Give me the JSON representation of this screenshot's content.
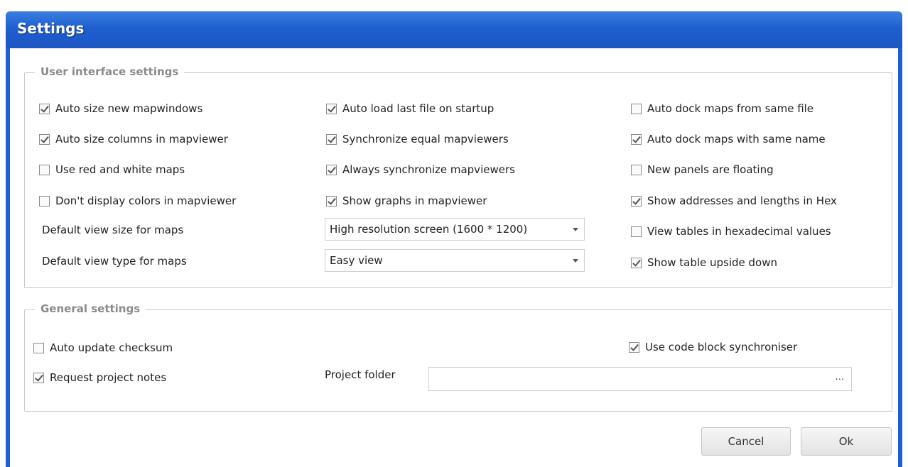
{
  "window": {
    "title": "Settings"
  },
  "ui_group": {
    "title": "User interface settings",
    "col1": [
      {
        "label": "Auto size new mapwindows",
        "checked": true
      },
      {
        "label": "Auto size columns in mapviewer",
        "checked": true
      },
      {
        "label": "Use red and white maps",
        "checked": false
      },
      {
        "label": "Don't display colors in mapviewer",
        "checked": false
      }
    ],
    "col2": [
      {
        "label": "Auto load last file on startup",
        "checked": true
      },
      {
        "label": "Synchronize equal mapviewers",
        "checked": true
      },
      {
        "label": "Always synchronize mapviewers",
        "checked": true
      },
      {
        "label": "Show graphs in mapviewer",
        "checked": true
      }
    ],
    "col3": [
      {
        "label": "Auto dock maps from same file",
        "checked": false
      },
      {
        "label": "Auto dock maps with same name",
        "checked": true
      },
      {
        "label": "New panels are floating",
        "checked": false
      },
      {
        "label": "Show addresses and lengths in Hex",
        "checked": true
      },
      {
        "label": "View tables in hexadecimal values",
        "checked": false
      },
      {
        "label": "Show table upside down",
        "checked": true
      }
    ],
    "view_size_label": "Default view size for maps",
    "view_size_value": "High resolution screen (1600 * 1200)",
    "view_type_label": "Default view type for maps",
    "view_type_value": "Easy view"
  },
  "general_group": {
    "title": "General settings",
    "auto_update_checksum": {
      "label": "Auto update checksum",
      "checked": false
    },
    "request_project_notes": {
      "label": "Request project notes",
      "checked": true
    },
    "use_code_block_sync": {
      "label": "Use code block synchroniser",
      "checked": true
    },
    "project_folder_label": "Project folder",
    "project_folder_value": "",
    "browse_label": "..."
  },
  "buttons": {
    "cancel": "Cancel",
    "ok": "Ok"
  }
}
